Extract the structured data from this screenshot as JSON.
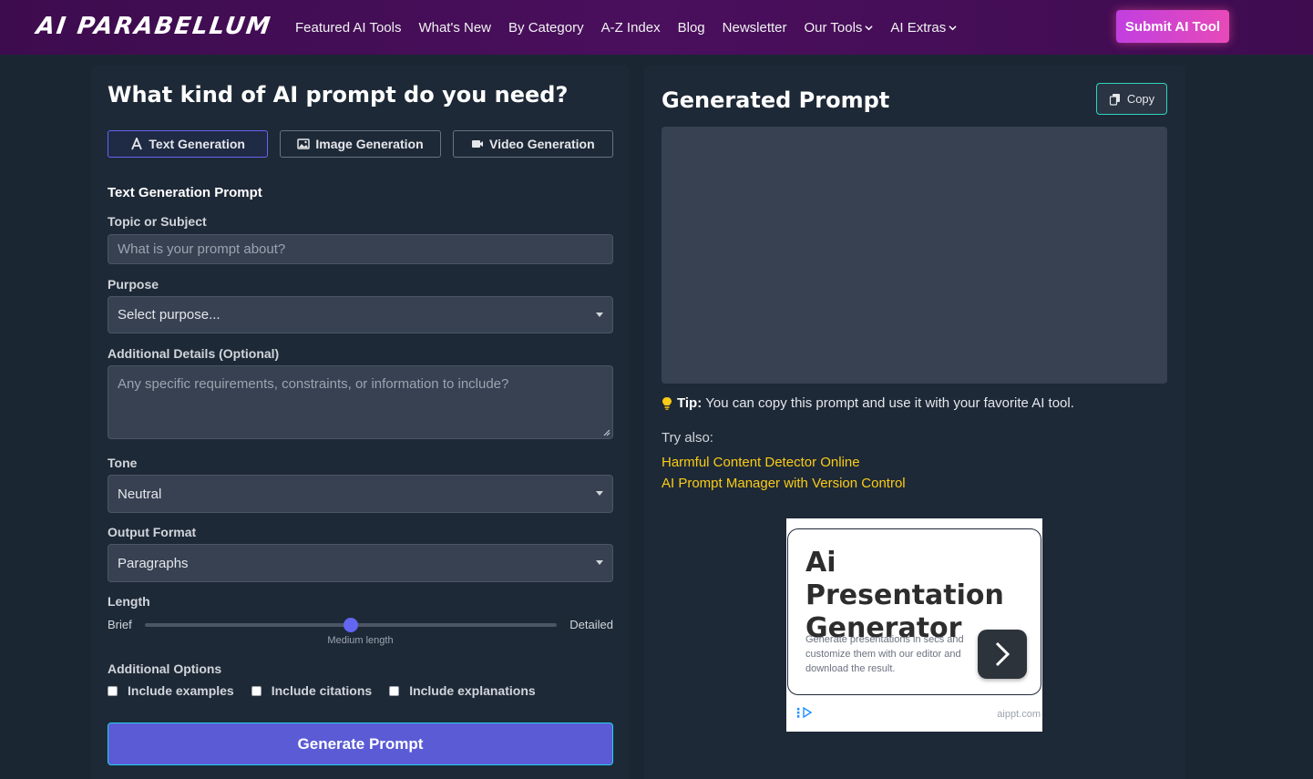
{
  "nav": {
    "logo": "AI PARABELLUM",
    "links": [
      "Featured AI Tools",
      "What's New",
      "By Category",
      "A-Z Index",
      "Blog",
      "Newsletter",
      "Our Tools",
      "AI Extras"
    ],
    "submit_label": "Submit AI Tool"
  },
  "form": {
    "heading": "What kind of AI prompt do you need?",
    "tabs": [
      {
        "label": "Text Generation",
        "icon": "text-icon",
        "active": true
      },
      {
        "label": "Image Generation",
        "icon": "image-icon",
        "active": false
      },
      {
        "label": "Video Generation",
        "icon": "video-icon",
        "active": false
      }
    ],
    "section_title": "Text Generation Prompt",
    "topic_label": "Topic or Subject",
    "topic_placeholder": "What is your prompt about?",
    "purpose_label": "Purpose",
    "purpose_value": "Select purpose...",
    "details_label": "Additional Details (Optional)",
    "details_placeholder": "Any specific requirements, constraints, or information to include?",
    "tone_label": "Tone",
    "tone_value": "Neutral",
    "format_label": "Output Format",
    "format_value": "Paragraphs",
    "length_label": "Length",
    "length_min": "Brief",
    "length_max": "Detailed",
    "length_caption": "Medium length",
    "length_fraction": 0.5,
    "options_label": "Additional Options",
    "options": [
      {
        "label": "Include examples",
        "checked": false
      },
      {
        "label": "Include citations",
        "checked": false
      },
      {
        "label": "Include explanations",
        "checked": false
      }
    ],
    "generate_label": "Generate Prompt"
  },
  "output": {
    "heading": "Generated Prompt",
    "copy_label": "Copy",
    "tip_bold": "Tip:",
    "tip_text": "You can copy this prompt and use it with your favorite AI tool.",
    "try_label": "Try also:",
    "try_links": [
      "Harmful Content Detector Online",
      "AI Prompt Manager with Version Control"
    ]
  },
  "ad": {
    "title": "Ai Presentation Generator",
    "description": "Generate presentations in secs and customize them with our editor and download the result.",
    "domain": "aippt.com"
  },
  "colors": {
    "accent": "#6366f1",
    "link": "#facc15",
    "submit_gradient_start": "#c13fe0",
    "submit_gradient_end": "#e74ab8",
    "copy_border": "#2dd4bf"
  }
}
